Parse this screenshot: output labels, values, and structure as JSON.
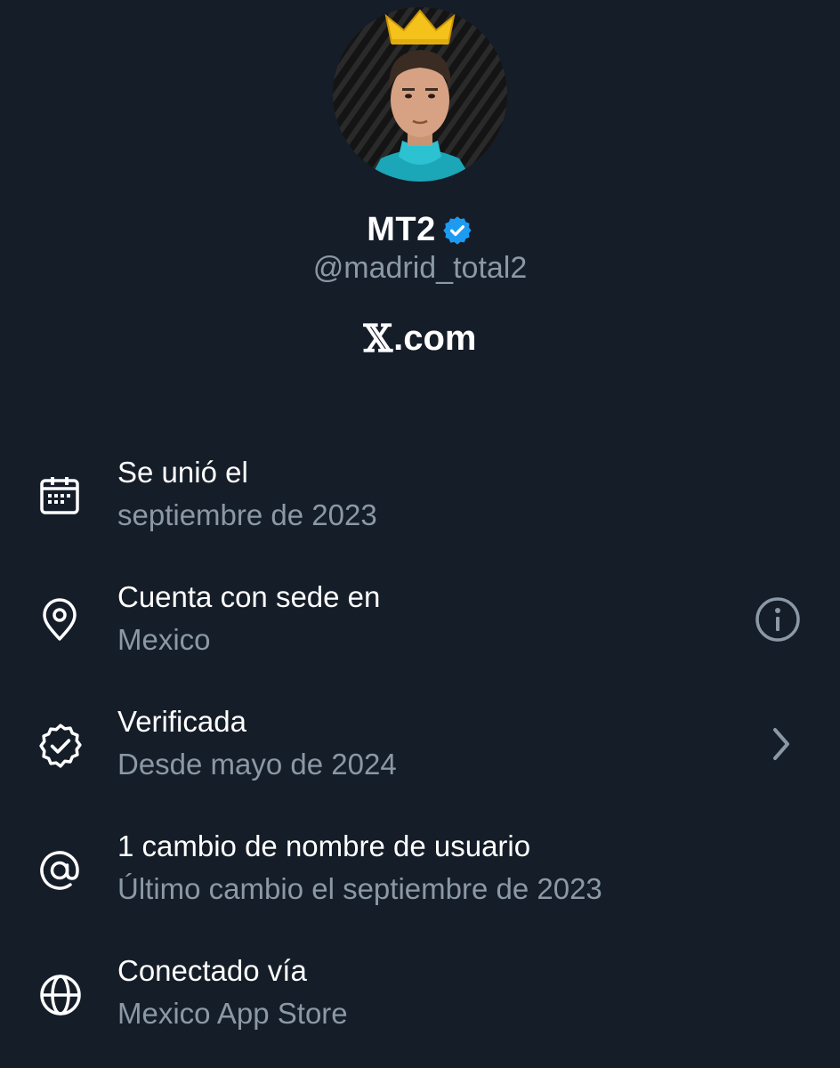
{
  "profile": {
    "display_name": "MT2",
    "handle": "@madrid_total2",
    "brand_suffix": ".com",
    "brand_mark_icon": "x-logo-icon",
    "verified_icon": "verified-badge-icon",
    "avatar_icon": "profile-photo-with-crown"
  },
  "colors": {
    "background": "#151d28",
    "primary_text": "#ffffff",
    "secondary_text": "#8b98a5",
    "verified_blue": "#1d9bf0"
  },
  "about": {
    "items": [
      {
        "icon": "calendar-icon",
        "title": "Se unió el",
        "subtitle": "septiembre de 2023"
      },
      {
        "icon": "location-pin-icon",
        "title": "Cuenta con sede en",
        "subtitle": "Mexico",
        "trailing_icon": "info-icon"
      },
      {
        "icon": "verified-outline-icon",
        "title": "Verificada",
        "subtitle": "Desde mayo de 2024",
        "trailing_icon": "chevron-right-icon"
      },
      {
        "icon": "at-sign-icon",
        "title": "1 cambio de nombre de usuario",
        "subtitle": "Último cambio el septiembre de 2023"
      },
      {
        "icon": "globe-icon",
        "title": "Conectado vía",
        "subtitle": "Mexico App Store"
      }
    ]
  }
}
